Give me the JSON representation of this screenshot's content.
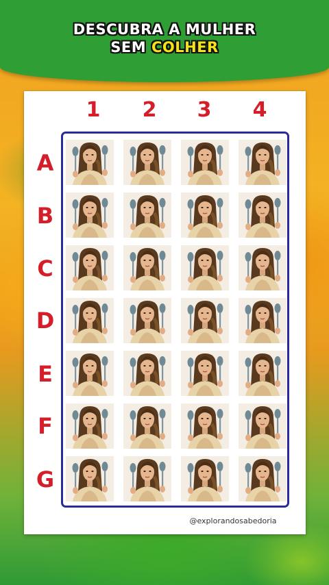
{
  "header": {
    "line1": "DESCUBRA A MULHER",
    "line2_prefix": "SEM ",
    "line2_highlight": "COLHER"
  },
  "columns": [
    "1",
    "2",
    "3",
    "4"
  ],
  "rows": [
    "A",
    "B",
    "C",
    "D",
    "E",
    "F",
    "G"
  ],
  "cell_image": "woman-holding-spoon-portrait",
  "credit": "@explorandosabedoria",
  "colors": {
    "header_green": "#2e9e35",
    "label_red": "#d41f2a",
    "grid_border": "#2a2a9a",
    "highlight_yellow": "#f5e21b"
  }
}
